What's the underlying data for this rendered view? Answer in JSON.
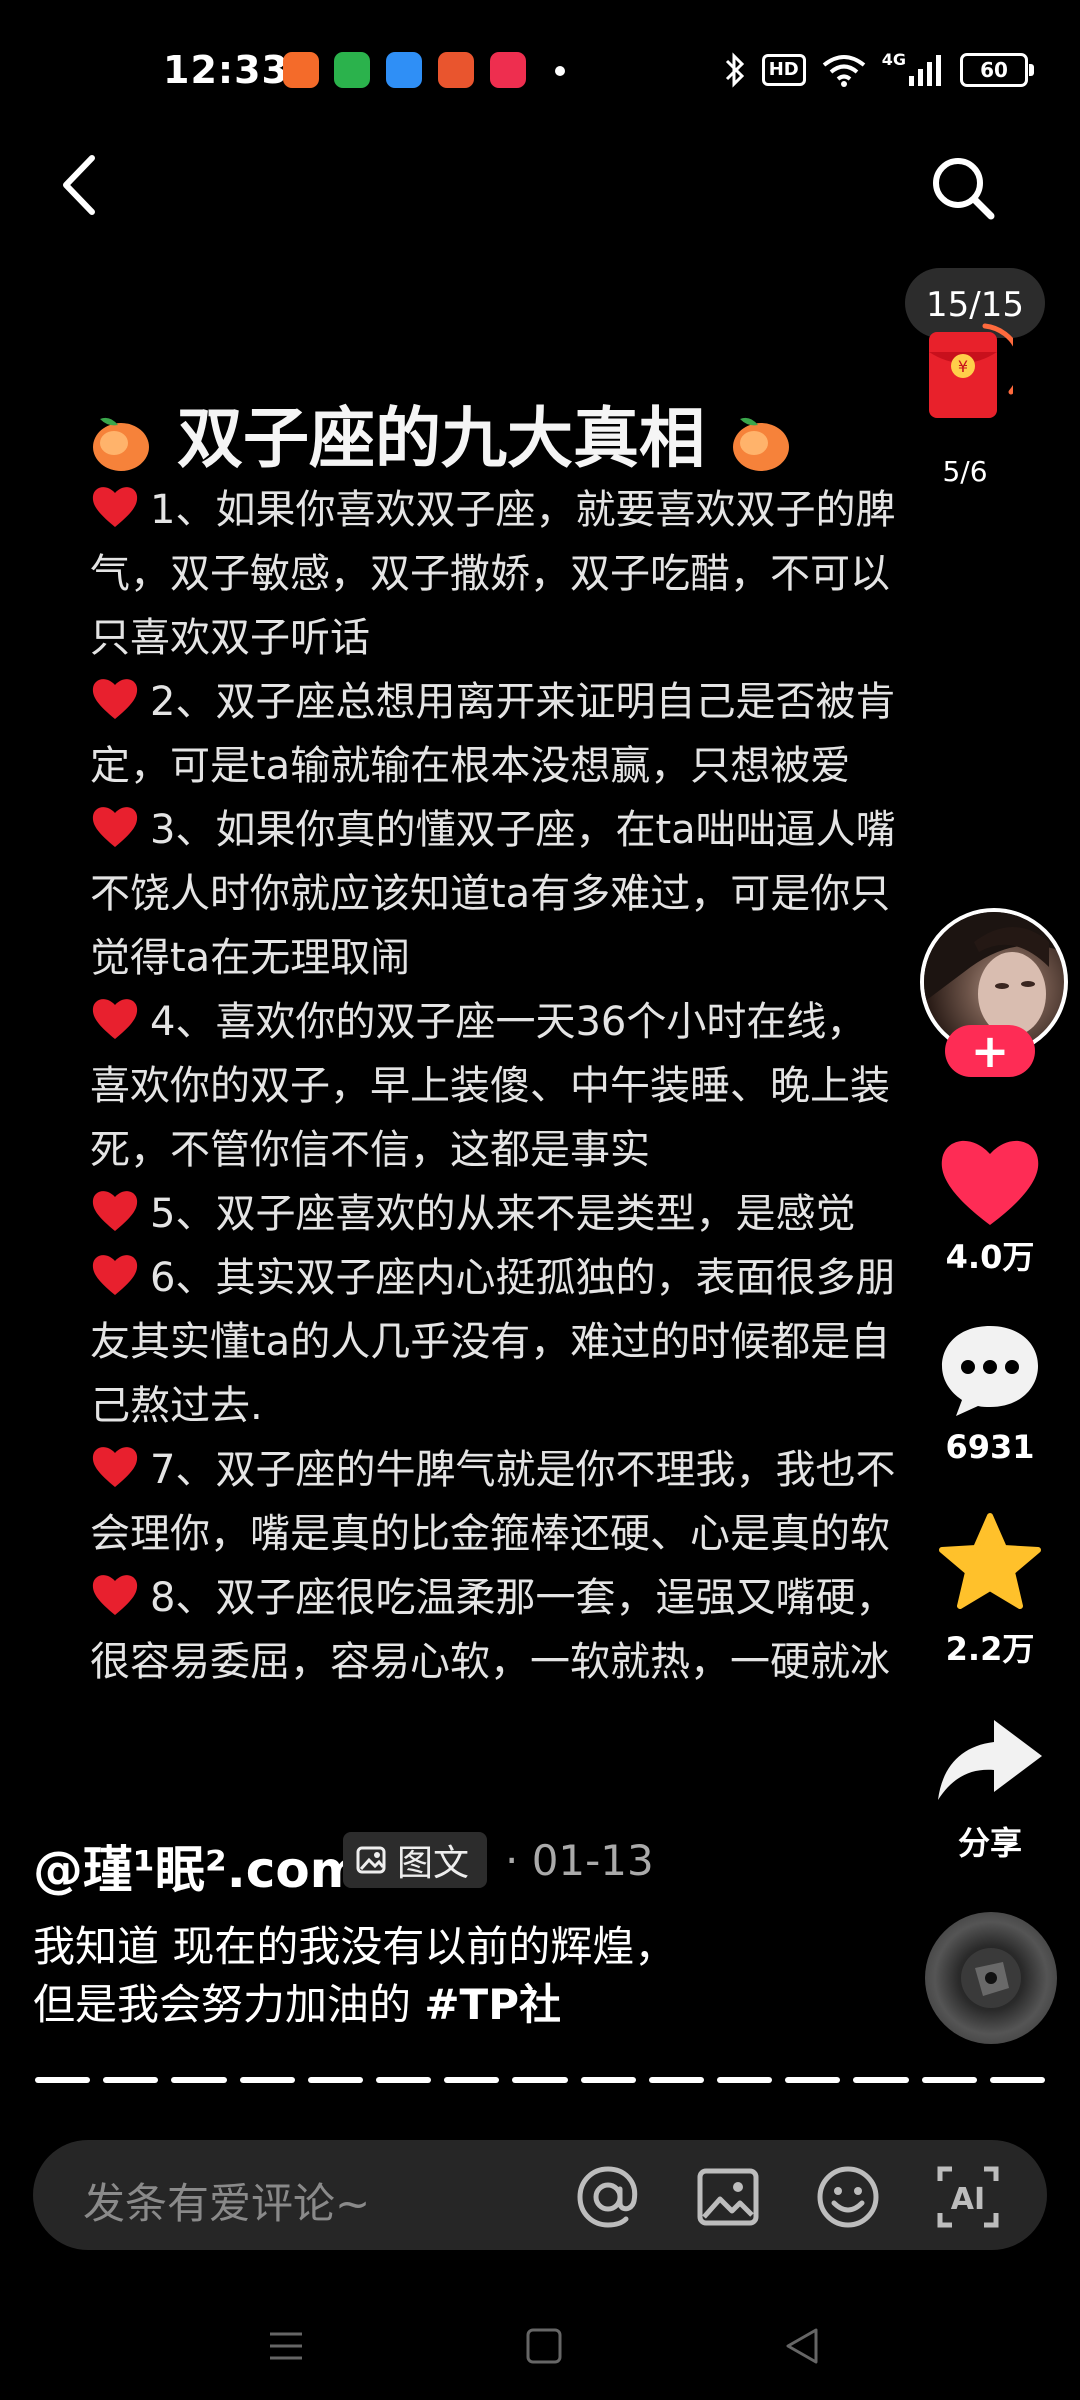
{
  "status_bar": {
    "time": "12:33",
    "network": "4G",
    "battery": "60",
    "hd_label": "HD",
    "app_icons": [
      {
        "name": "app-icon-orange",
        "color": "#f46b2a"
      },
      {
        "name": "app-icon-green",
        "color": "#2bb24c"
      },
      {
        "name": "app-icon-blue",
        "color": "#2f8ff6"
      },
      {
        "name": "app-icon-game",
        "color": "#e9552e"
      },
      {
        "name": "app-icon-music",
        "color": "#ee2e4f"
      }
    ]
  },
  "post": {
    "title": "双子座的九大真相",
    "body_lines": [
      {
        "heart": true,
        "text": "1、如果你喜欢双子座，就要喜欢双子的脾"
      },
      {
        "heart": false,
        "text": "气，双子敏感，双子撒娇，双子吃醋，不可以"
      },
      {
        "heart": false,
        "text": "只喜欢双子听话"
      },
      {
        "heart": true,
        "text": "2、双子座总想用离开来证明自己是否被肯"
      },
      {
        "heart": false,
        "text": "定，可是ta输就输在根本没想赢，只想被爱"
      },
      {
        "heart": true,
        "text": "3、如果你真的懂双子座，在ta咄咄逼人嘴"
      },
      {
        "heart": false,
        "text": "不饶人时你就应该知道ta有多难过，可是你只"
      },
      {
        "heart": false,
        "text": "觉得ta在无理取闹"
      },
      {
        "heart": true,
        "text": "4、喜欢你的双子座一天36个小时在线，"
      },
      {
        "heart": false,
        "text": "喜欢你的双子，早上装傻、中午装睡、晚上装"
      },
      {
        "heart": false,
        "text": "死，不管你信不信，这都是事实"
      },
      {
        "heart": true,
        "text": "5、双子座喜欢的从来不是类型，是感觉"
      },
      {
        "heart": true,
        "text": "6、其实双子座内心挺孤独的，表面很多朋"
      },
      {
        "heart": false,
        "text": "友其实懂ta的人几乎没有，难过的时候都是自"
      },
      {
        "heart": false,
        "text": "己熬过去."
      },
      {
        "heart": true,
        "text": "7、双子座的牛脾气就是你不理我，我也不"
      },
      {
        "heart": false,
        "text": "会理你，嘴是真的比金箍棒还硬、心是真的软"
      },
      {
        "heart": true,
        "text": "8、双子座很吃温柔那一套，逞强又嘴硬，"
      },
      {
        "heart": false,
        "text": "很容易委屈，容易心软，一软就热，一硬就冰"
      }
    ]
  },
  "red_packet": {
    "counter": "15/15",
    "progress": "5/6"
  },
  "actions": {
    "likes": "4.0万",
    "comments": "6931",
    "favorites": "2.2万",
    "share": "分享"
  },
  "author": {
    "name": "@瑾¹眠².com",
    "type_badge": "图文",
    "date": "· 01-13"
  },
  "caption": {
    "line1": "我知道 现在的我没有以前的辉煌，",
    "line2_text": "但是我会努力加油的 ",
    "hashtag": "#TP社"
  },
  "pagination": {
    "total_pages": 15,
    "current_page": 15
  },
  "comment_bar": {
    "placeholder": "发条有爱评论~"
  },
  "colors": {
    "accent": "#fe2c55",
    "like": "#fe2c55",
    "favorite": "#ffc12b",
    "bar_bg": "#262626"
  }
}
